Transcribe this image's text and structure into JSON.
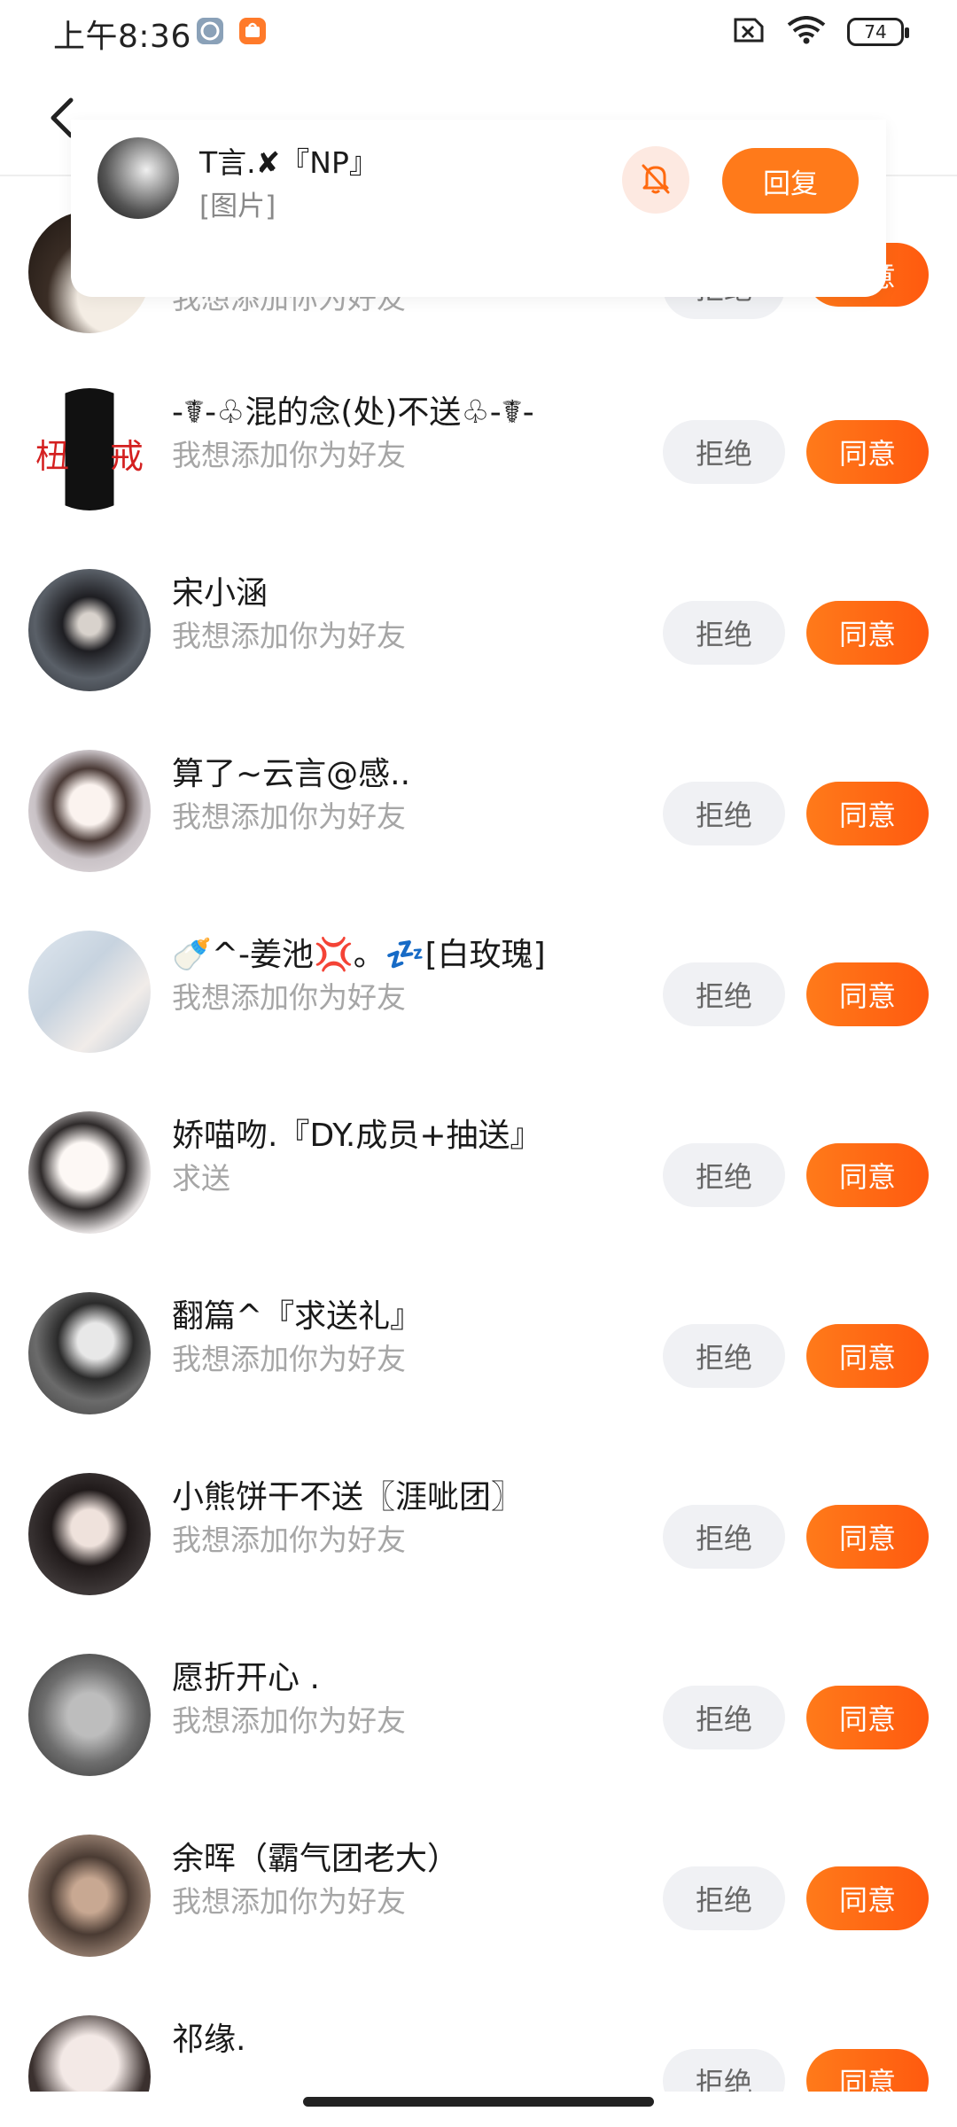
{
  "status_bar": {
    "time": "上午8:36",
    "battery": "74"
  },
  "notification": {
    "name": "T言.✘『NP』",
    "message": "[图片]",
    "reply_label": "回复"
  },
  "requests": [
    {
      "name": "",
      "message": "我想添加你为好友",
      "reject": "拒绝",
      "accept": "同意"
    },
    {
      "name": "-☤-♧混的念(处)不送♧-☤-",
      "message": "我想添加你为好友",
      "reject": "拒绝",
      "accept": "同意"
    },
    {
      "name": "宋小涵",
      "message": "我想添加你为好友",
      "reject": "拒绝",
      "accept": "同意"
    },
    {
      "name": "算了~云言@感..",
      "message": "我想添加你为好友",
      "reject": "拒绝",
      "accept": "同意"
    },
    {
      "name": "🍼^-姜池💢。💤[白玫瑰]",
      "message": "我想添加你为好友",
      "reject": "拒绝",
      "accept": "同意"
    },
    {
      "name": "娇喵吻.『DY.成员+抽送』",
      "message": "求送",
      "reject": "拒绝",
      "accept": "同意"
    },
    {
      "name": "翻篇^『求送礼』",
      "message": "我想添加你为好友",
      "reject": "拒绝",
      "accept": "同意"
    },
    {
      "name": "小熊饼干不送〖涯呲团〗",
      "message": "我想添加你为好友",
      "reject": "拒绝",
      "accept": "同意"
    },
    {
      "name": "愿折开心 .",
      "message": "我想添加你为好友",
      "reject": "拒绝",
      "accept": "同意"
    },
    {
      "name": "余晖（霸气团老大）",
      "message": "我想添加你为好友",
      "reject": "拒绝",
      "accept": "同意"
    },
    {
      "name": "祁缘.",
      "message": "",
      "reject": "拒绝",
      "accept": "同意"
    }
  ],
  "colors": {
    "accent": "#ff6a10",
    "reject_bg": "#f0f1f4",
    "subtext": "#a6a6a6"
  },
  "icons": {
    "back": "back-arrow-icon",
    "mute": "bell-off-icon",
    "wifi": "wifi-icon",
    "sim": "no-sim-icon"
  }
}
